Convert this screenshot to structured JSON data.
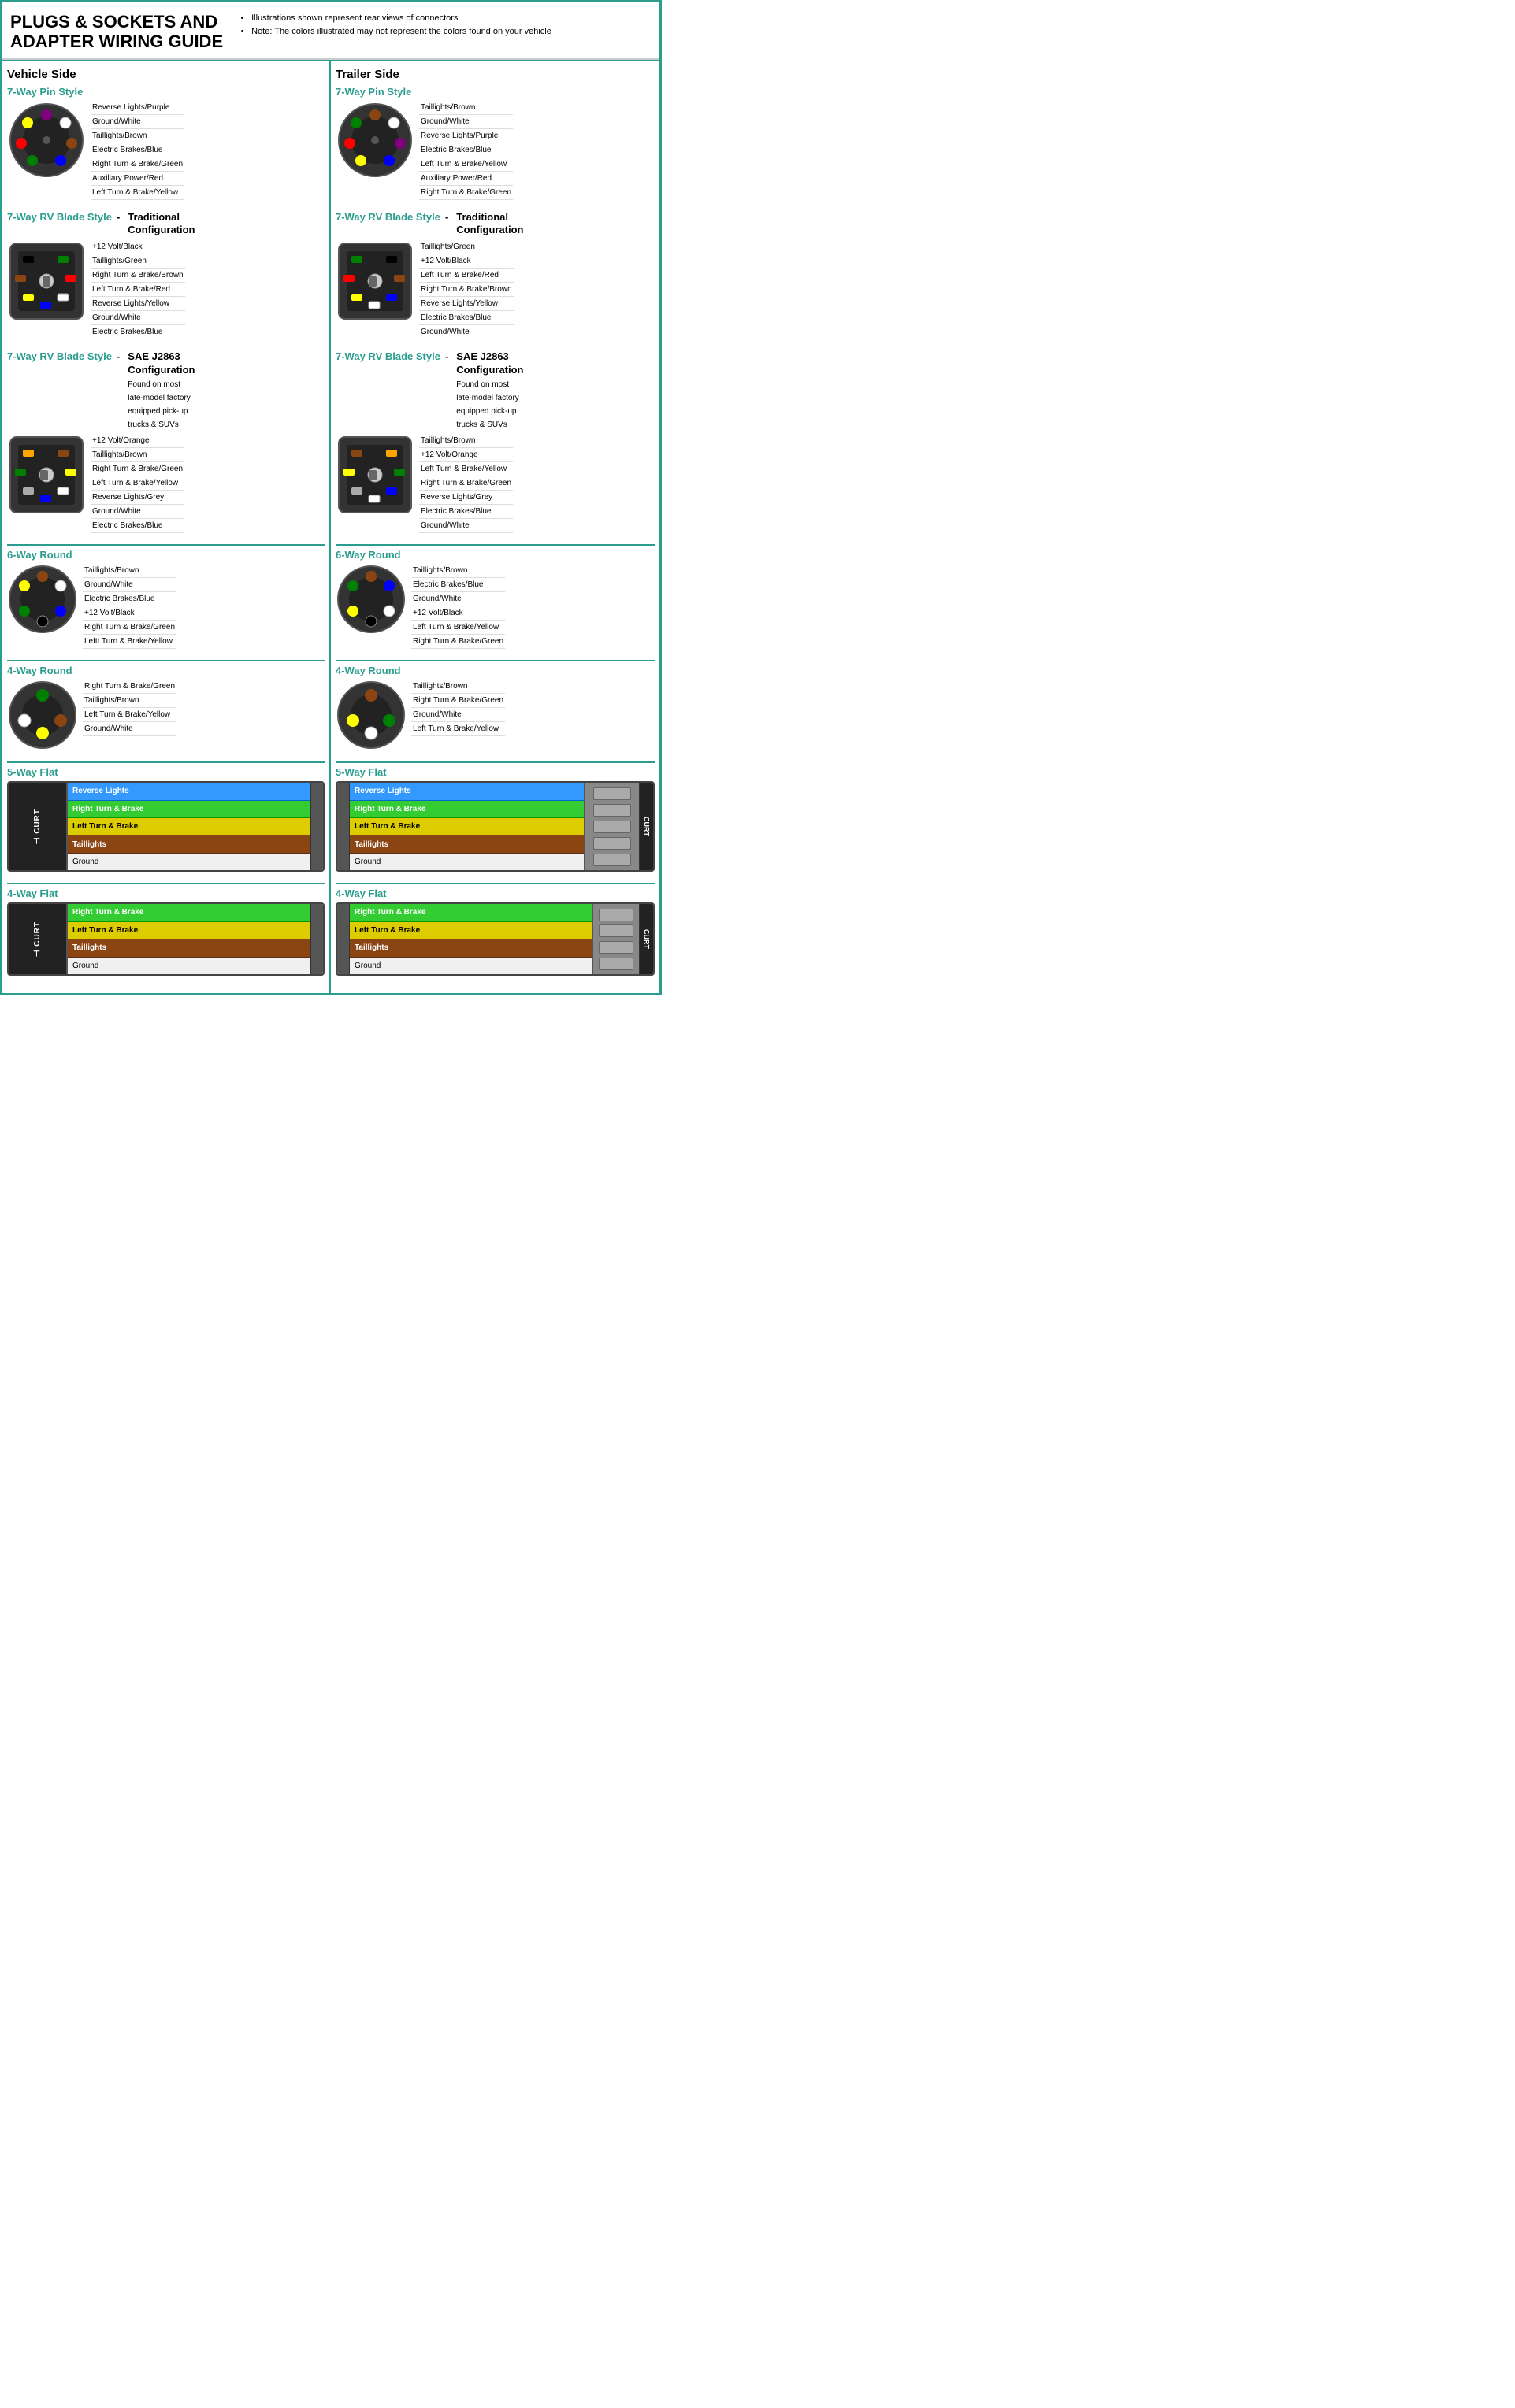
{
  "header": {
    "title": "PLUGS & SOCKETS AND\nADAPTER WIRING GUIDE",
    "notes": [
      "Illustrations shown represent rear views of connectors",
      "Note: The colors illustrated may not represent the colors found on your vehicle"
    ]
  },
  "vehicle_side": {
    "label": "Vehicle Side",
    "sections": [
      {
        "id": "7way-pin",
        "title": "7-Way Pin Style",
        "wires": [
          "Reverse Lights/Purple",
          "Ground/White",
          "Taillights/Brown",
          "Electric Brakes/Blue",
          "Right Turn & Brake/Green",
          "Auxiliary Power/Red",
          "Left Turn & Brake/Yellow"
        ],
        "colors": [
          "purple",
          "white",
          "brown",
          "blue",
          "green",
          "red",
          "yellow"
        ]
      },
      {
        "id": "7way-rv-trad",
        "title": "7-Way RV Blade Style",
        "config": "Traditional\nConfiguration",
        "wires": [
          "+12 Volt/Black",
          "Taillights/Green",
          "Right Turn & Brake/Brown",
          "Left Turn & Brake/Red",
          "Reverse Lights/Yellow",
          "Ground/White",
          "Electric Brakes/Blue"
        ],
        "colors": [
          "black",
          "green",
          "brown",
          "red",
          "yellow",
          "white",
          "blue"
        ]
      },
      {
        "id": "7way-rv-sae",
        "title": "7-Way RV Blade Style",
        "config": "SAE J2863\nConfiguration",
        "config_sub": "Found on most\nlate-model factory\nequipped pick-up\ntrucks & SUVs",
        "wires": [
          "+12 Volt/Orange",
          "Taillights/Brown",
          "Right Turn & Brake/Green",
          "Left Turn & Brake/Yellow",
          "Reverse Lights/Grey",
          "Ground/White",
          "Electric Brakes/Blue"
        ],
        "colors": [
          "orange",
          "brown",
          "green",
          "yellow",
          "grey",
          "white",
          "blue"
        ]
      },
      {
        "id": "6way-round",
        "title": "6-Way Round",
        "wires": [
          "Taillights/Brown",
          "Ground/White",
          "Electric Brakes/Blue",
          "+12 Volt/Black",
          "Right Turn & Brake/Green",
          "Leftt Turn & Brake/Yellow"
        ],
        "colors": [
          "brown",
          "white",
          "blue",
          "black",
          "green",
          "yellow"
        ]
      },
      {
        "id": "4way-round",
        "title": "4-Way Round",
        "wires": [
          "Right Turn & Brake/Green",
          "Taillights/Brown",
          "Left Turn & Brake/Yellow",
          "Ground/White"
        ],
        "colors": [
          "green",
          "brown",
          "yellow",
          "white"
        ]
      },
      {
        "id": "5way-flat",
        "title": "5-Way Flat",
        "wires": [
          {
            "label": "Reverse Lights",
            "color": "#3399ff"
          },
          {
            "label": "Right Turn & Brake",
            "color": "#33cc33"
          },
          {
            "label": "Left Turn & Brake",
            "color": "#ffdd00"
          },
          {
            "label": "Taillights",
            "color": "#8b4513"
          },
          {
            "label": "Ground",
            "color": "#fff",
            "text_color": "#000"
          }
        ]
      },
      {
        "id": "4way-flat",
        "title": "4-Way Flat",
        "wires": [
          {
            "label": "Right Turn & Brake",
            "color": "#33cc33"
          },
          {
            "label": "Left Turn & Brake",
            "color": "#ffdd00"
          },
          {
            "label": "Taillights",
            "color": "#8b4513"
          },
          {
            "label": "Ground",
            "color": "#fff",
            "text_color": "#000"
          }
        ]
      }
    ]
  },
  "trailer_side": {
    "label": "Trailer Side",
    "sections": [
      {
        "id": "7way-pin",
        "title": "7-Way Pin Style",
        "wires": [
          "Taillights/Brown",
          "Ground/White",
          "Reverse Lights/Purple",
          "Electric Brakes/Blue",
          "Left Turn & Brake/Yellow",
          "Auxiliary Power/Red",
          "Right Turn & Brake/Green"
        ],
        "colors": [
          "brown",
          "white",
          "purple",
          "blue",
          "yellow",
          "red",
          "green"
        ]
      },
      {
        "id": "7way-rv-trad",
        "title": "7-Way RV Blade Style",
        "config": "Traditional\nConfiguration",
        "wires": [
          "Taillights/Green",
          "+12 Volt/Black",
          "Left Turn & Brake/Red",
          "Right Turn & Brake/Brown",
          "Reverse Lights/Yellow",
          "Electric Brakes/Blue",
          "Ground/White"
        ],
        "colors": [
          "green",
          "black",
          "red",
          "brown",
          "yellow",
          "blue",
          "white"
        ]
      },
      {
        "id": "7way-rv-sae",
        "title": "7-Way RV Blade Style",
        "config": "SAE J2863\nConfiguration",
        "config_sub": "Found on most\nlate-model factory\nequipped pick-up\ntrucks & SUVs",
        "wires": [
          "Taillights/Brown",
          "+12 Volt/Orange",
          "Left Turn & Brake/Yellow",
          "Right Turn & Brake/Green",
          "Reverse Lights/Grey",
          "Electric Brakes/Blue",
          "Ground/White"
        ],
        "colors": [
          "brown",
          "orange",
          "yellow",
          "green",
          "grey",
          "blue",
          "white"
        ]
      },
      {
        "id": "6way-round",
        "title": "6-Way Round",
        "wires": [
          "Taillights/Brown",
          "Electric Brakes/Blue",
          "Ground/White",
          "+12 Volt/Black",
          "Left Turn & Brake/Yellow",
          "Right Turn & Brake/Green"
        ],
        "colors": [
          "brown",
          "blue",
          "white",
          "black",
          "yellow",
          "green"
        ]
      },
      {
        "id": "4way-round",
        "title": "4-Way Round",
        "wires": [
          "Taillights/Brown",
          "Right Turn & Brake/Green",
          "Ground/White",
          "Left Turn & Brake/Yellow"
        ],
        "colors": [
          "brown",
          "green",
          "white",
          "yellow"
        ]
      },
      {
        "id": "5way-flat",
        "title": "5-Way Flat",
        "wires": [
          {
            "label": "Reverse Lights",
            "color": "#3399ff"
          },
          {
            "label": "Right Turn & Brake",
            "color": "#33cc33"
          },
          {
            "label": "Left Turn & Brake",
            "color": "#ffdd00"
          },
          {
            "label": "Taillights",
            "color": "#8b4513"
          },
          {
            "label": "Ground",
            "color": "#fff",
            "text_color": "#000"
          }
        ]
      },
      {
        "id": "4way-flat",
        "title": "4-Way Flat",
        "wires": [
          {
            "label": "Right Turn & Brake",
            "color": "#33cc33"
          },
          {
            "label": "Left Turn & Brake",
            "color": "#ffdd00"
          },
          {
            "label": "Taillights",
            "color": "#8b4513"
          },
          {
            "label": "Ground",
            "color": "#fff",
            "text_color": "#000"
          }
        ]
      }
    ]
  },
  "brand": "CURT",
  "accent_color": "#2a9d8f"
}
